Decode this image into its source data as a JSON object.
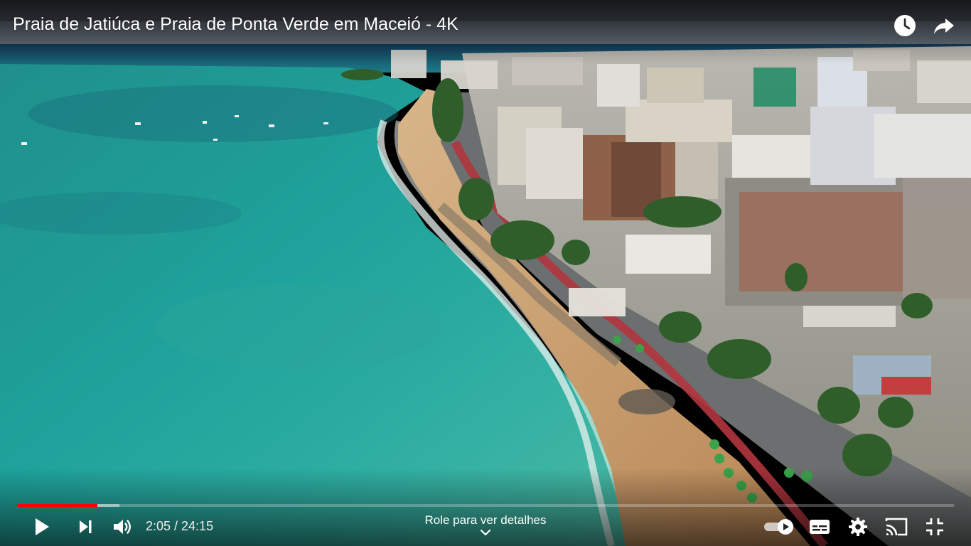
{
  "video": {
    "title": "Praia de Jatiúca e Praia de Ponta Verde em Maceió - 4K"
  },
  "top_actions": {
    "watch_later_icon": "clock-icon",
    "share_icon": "share-arrow-icon"
  },
  "playback": {
    "current_time": "2:05",
    "duration": "24:15",
    "time_display": "2:05 / 24:15",
    "played_fraction": 0.086,
    "loaded_fraction": 0.109
  },
  "scroll_hint": {
    "label": "Role para ver detalhes",
    "icon": "chevron-down-icon"
  },
  "controls": {
    "play_icon": "play-icon",
    "next_icon": "skip-next-icon",
    "volume_icon": "volume-high-icon",
    "autoplay_icon": "autoplay-toggle-icon",
    "autoplay_on": true,
    "subtitles_icon": "subtitles-icon",
    "settings_icon": "gear-icon",
    "cast_icon": "cast-icon",
    "fullscreen_icon": "exit-fullscreen-icon"
  },
  "colors": {
    "progress_played": "#ff0000",
    "ocean": "#1f9a94",
    "sand": "#c9955f"
  }
}
